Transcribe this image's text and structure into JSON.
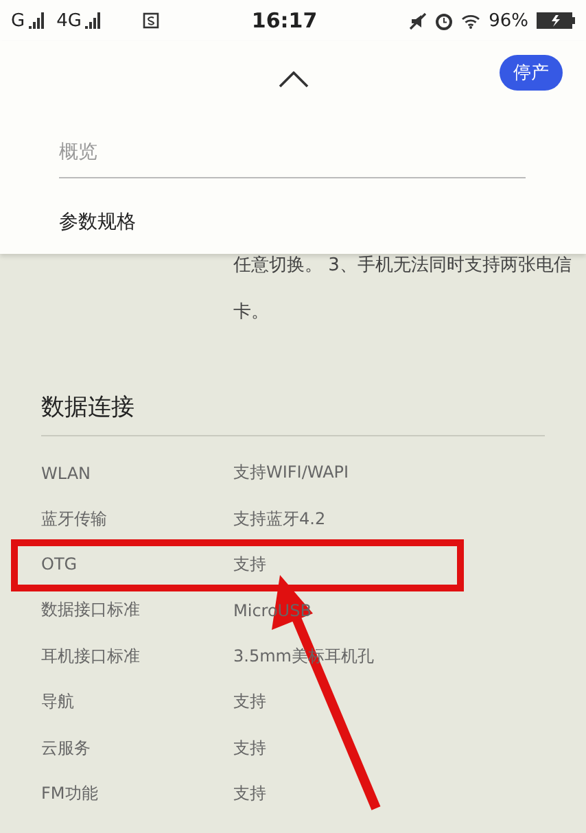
{
  "status_bar": {
    "carrier_1": "G",
    "carrier_2": "4G",
    "time": "16:17",
    "battery": "96%"
  },
  "header": {
    "badge": "停产",
    "menu": [
      {
        "label": "概览",
        "selected": false
      },
      {
        "label": "参数规格",
        "selected": true
      }
    ]
  },
  "intro": {
    "lines": [
      "任意切换。 3、手机无法同时支持两张电信",
      "卡。"
    ]
  },
  "section": {
    "title": "数据连接",
    "rows": [
      {
        "label": "WLAN",
        "value": "支持WIFI/WAPI",
        "highlighted": false
      },
      {
        "label": "蓝牙传输",
        "value": "支持蓝牙4.2",
        "highlighted": false
      },
      {
        "label": "OTG",
        "value": "支持",
        "highlighted": true
      },
      {
        "label": "数据接口标准",
        "value": "MicroUSB",
        "highlighted": false
      },
      {
        "label": "耳机接口标准",
        "value": "3.5mm美标耳机孔",
        "highlighted": false
      },
      {
        "label": "导航",
        "value": "支持",
        "highlighted": false
      },
      {
        "label": "云服务",
        "value": "支持",
        "highlighted": false
      },
      {
        "label": "FM功能",
        "value": "支持",
        "highlighted": false
      }
    ]
  }
}
